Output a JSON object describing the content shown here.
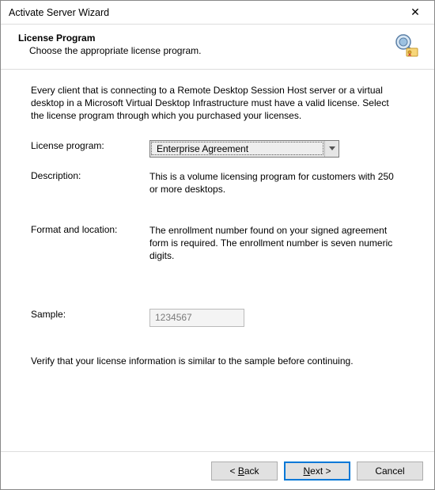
{
  "window": {
    "title": "Activate Server Wizard"
  },
  "header": {
    "title": "License Program",
    "subtitle": "Choose the appropriate license program."
  },
  "content": {
    "intro": "Every client that is connecting to a Remote Desktop Session Host server or a virtual desktop in a Microsoft Virtual Desktop Infrastructure must have a valid license. Select the license program through which you purchased your licenses.",
    "labels": {
      "program": "License program:",
      "description": "Description:",
      "format": "Format and location:",
      "sample": "Sample:"
    },
    "values": {
      "program": "Enterprise Agreement",
      "description": "This is a volume licensing program for customers with 250 or more desktops.",
      "format": "The enrollment number found on your signed agreement form is required. The enrollment number is seven numeric digits.",
      "sample": "1234567"
    },
    "verify": "Verify that your license information is similar to the sample before continuing."
  },
  "footer": {
    "back": "< Back",
    "next": "Next >",
    "cancel": "Cancel"
  }
}
